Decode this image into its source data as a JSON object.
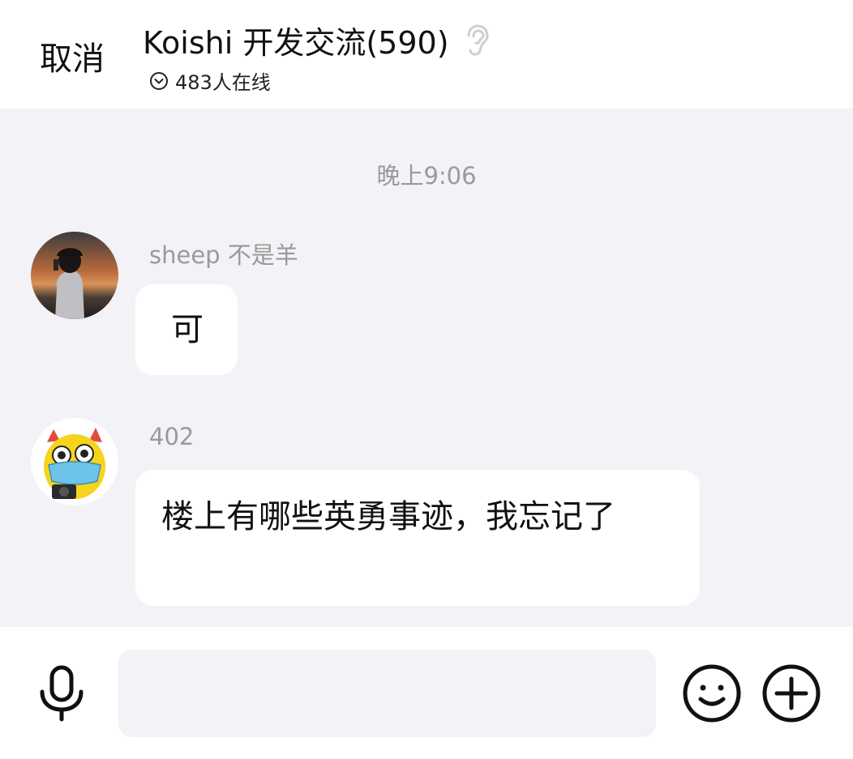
{
  "header": {
    "cancel_label": "取消",
    "title": "Koishi 开发交流(590)",
    "online_text": "483人在线"
  },
  "chat": {
    "timestamp": "晚上9:06",
    "messages": [
      {
        "sender": "sheep 不是羊",
        "text": "可"
      },
      {
        "sender": "402",
        "text": "楼上有哪些英勇事迹，我忘记了"
      }
    ]
  },
  "input": {
    "placeholder": ""
  },
  "icons": {
    "ear": "ear-icon",
    "online": "chevron-down-circle-icon",
    "mic": "microphone-icon",
    "emoji": "smiley-icon",
    "plus": "plus-circle-icon"
  },
  "colors": {
    "chat_background": "#f3f2f6",
    "bubble": "#ffffff",
    "secondary_text": "#9a9a9a"
  }
}
